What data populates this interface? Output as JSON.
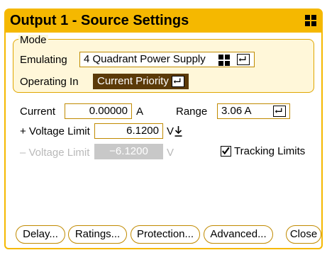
{
  "window": {
    "title": "Output 1 - Source Settings"
  },
  "mode": {
    "label": "Mode",
    "emulating_label": "Emulating",
    "emulating_value": "4 Quadrant Power Supply",
    "operating_label": "Operating In",
    "operating_value": "Current Priority"
  },
  "settings": {
    "current_label": "Current",
    "current_value": "0.00000",
    "current_unit": "A",
    "range_label": "Range",
    "range_value": "3.06 A",
    "pos_voltage_label": "+ Voltage Limit",
    "pos_voltage_value": "6.1200",
    "pos_voltage_unit": "V",
    "neg_voltage_label": "– Voltage Limit",
    "neg_voltage_value": "−6.1200",
    "neg_voltage_unit": "V",
    "tracking_label": "Tracking Limits",
    "tracking_checked": true
  },
  "buttons": {
    "delay": "Delay...",
    "ratings": "Ratings...",
    "protection": "Protection...",
    "advanced": "Advanced...",
    "close": "Close"
  },
  "colors": {
    "accent": "#f5b800",
    "mode_bg": "#fff7d9",
    "selected_field_bg": "#5b3a08",
    "disabled_text": "#b9b9b9"
  }
}
